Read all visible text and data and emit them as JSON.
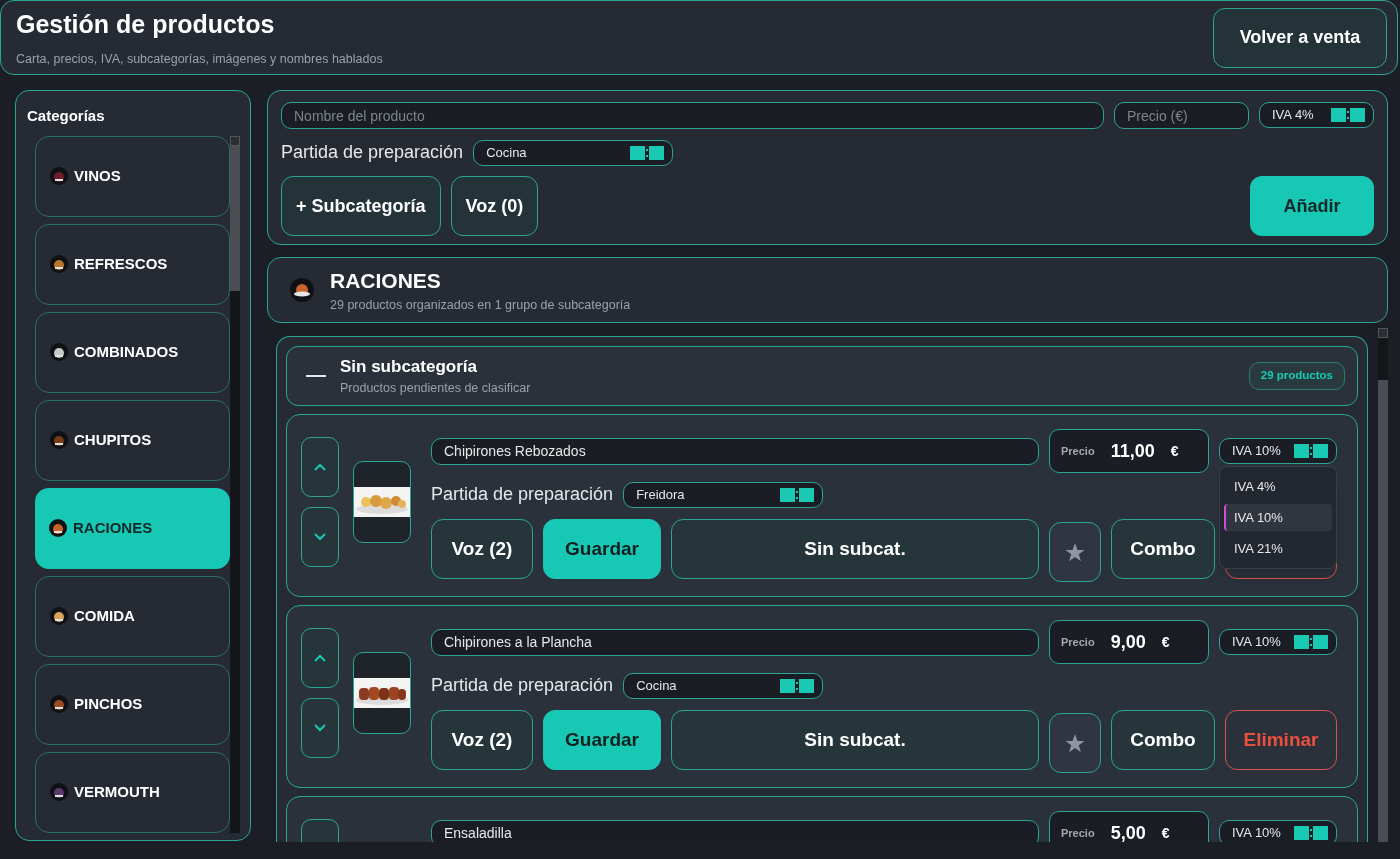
{
  "header": {
    "title": "Gestión de productos",
    "subtitle": "Carta, precios, IVA, subcategorías, imágenes y nombres hablados",
    "back_button": "Volver a venta"
  },
  "sidebar": {
    "title": "Categorías",
    "items": [
      {
        "label": "VINOS",
        "selected": false
      },
      {
        "label": "REFRESCOS",
        "selected": false
      },
      {
        "label": "COMBINADOS",
        "selected": false
      },
      {
        "label": "CHUPITOS",
        "selected": false
      },
      {
        "label": "RACIONES",
        "selected": true
      },
      {
        "label": "COMIDA",
        "selected": false
      },
      {
        "label": "PINCHOS",
        "selected": false
      },
      {
        "label": "VERMOUTH",
        "selected": false
      }
    ]
  },
  "new_product": {
    "name_placeholder": "Nombre del producto",
    "price_placeholder": "Precio (€)",
    "iva": "IVA 4%",
    "station_label": "Partida de preparación",
    "station": "Cocina",
    "buttons": [
      "+ Subcategoría",
      "Voz (0)"
    ],
    "add_button": "Añadir"
  },
  "category": {
    "title": "RACIONES",
    "subtitle": "29 productos organizados en 1 grupo de subcategoría"
  },
  "group": {
    "title": "Sin subcategoría",
    "subtitle": "Productos pendientes de clasificar",
    "badge": "29 productos"
  },
  "products": [
    {
      "name": "Chipirones Rebozados",
      "price_label": "Precio",
      "price": "11,00",
      "currency": "€",
      "iva": "IVA 10%",
      "station_label": "Partida de preparación",
      "station": "Freidora",
      "voice": "Voz (2)",
      "save": "Guardar",
      "subcategory": "Sin subcat.",
      "favorite": false,
      "combo": "Combo",
      "iva_options": [
        {
          "label": "IVA 4%",
          "selected": false
        },
        {
          "label": "IVA 10%",
          "selected": true
        },
        {
          "label": "IVA 21%",
          "selected": false
        }
      ]
    },
    {
      "name": "Chipirones a la Plancha",
      "price_label": "Precio",
      "price": "9,00",
      "currency": "€",
      "iva": "IVA 10%",
      "station_label": "Partida de preparación",
      "station": "Cocina",
      "voice": "Voz (2)",
      "save": "Guardar",
      "subcategory": "Sin subcat.",
      "favorite": false,
      "combo": "Combo",
      "delete": "Eliminar"
    },
    {
      "name": "Ensaladilla",
      "price_label": "Precio",
      "price": "5,00",
      "currency": "€",
      "iva": "IVA 10%"
    }
  ]
}
